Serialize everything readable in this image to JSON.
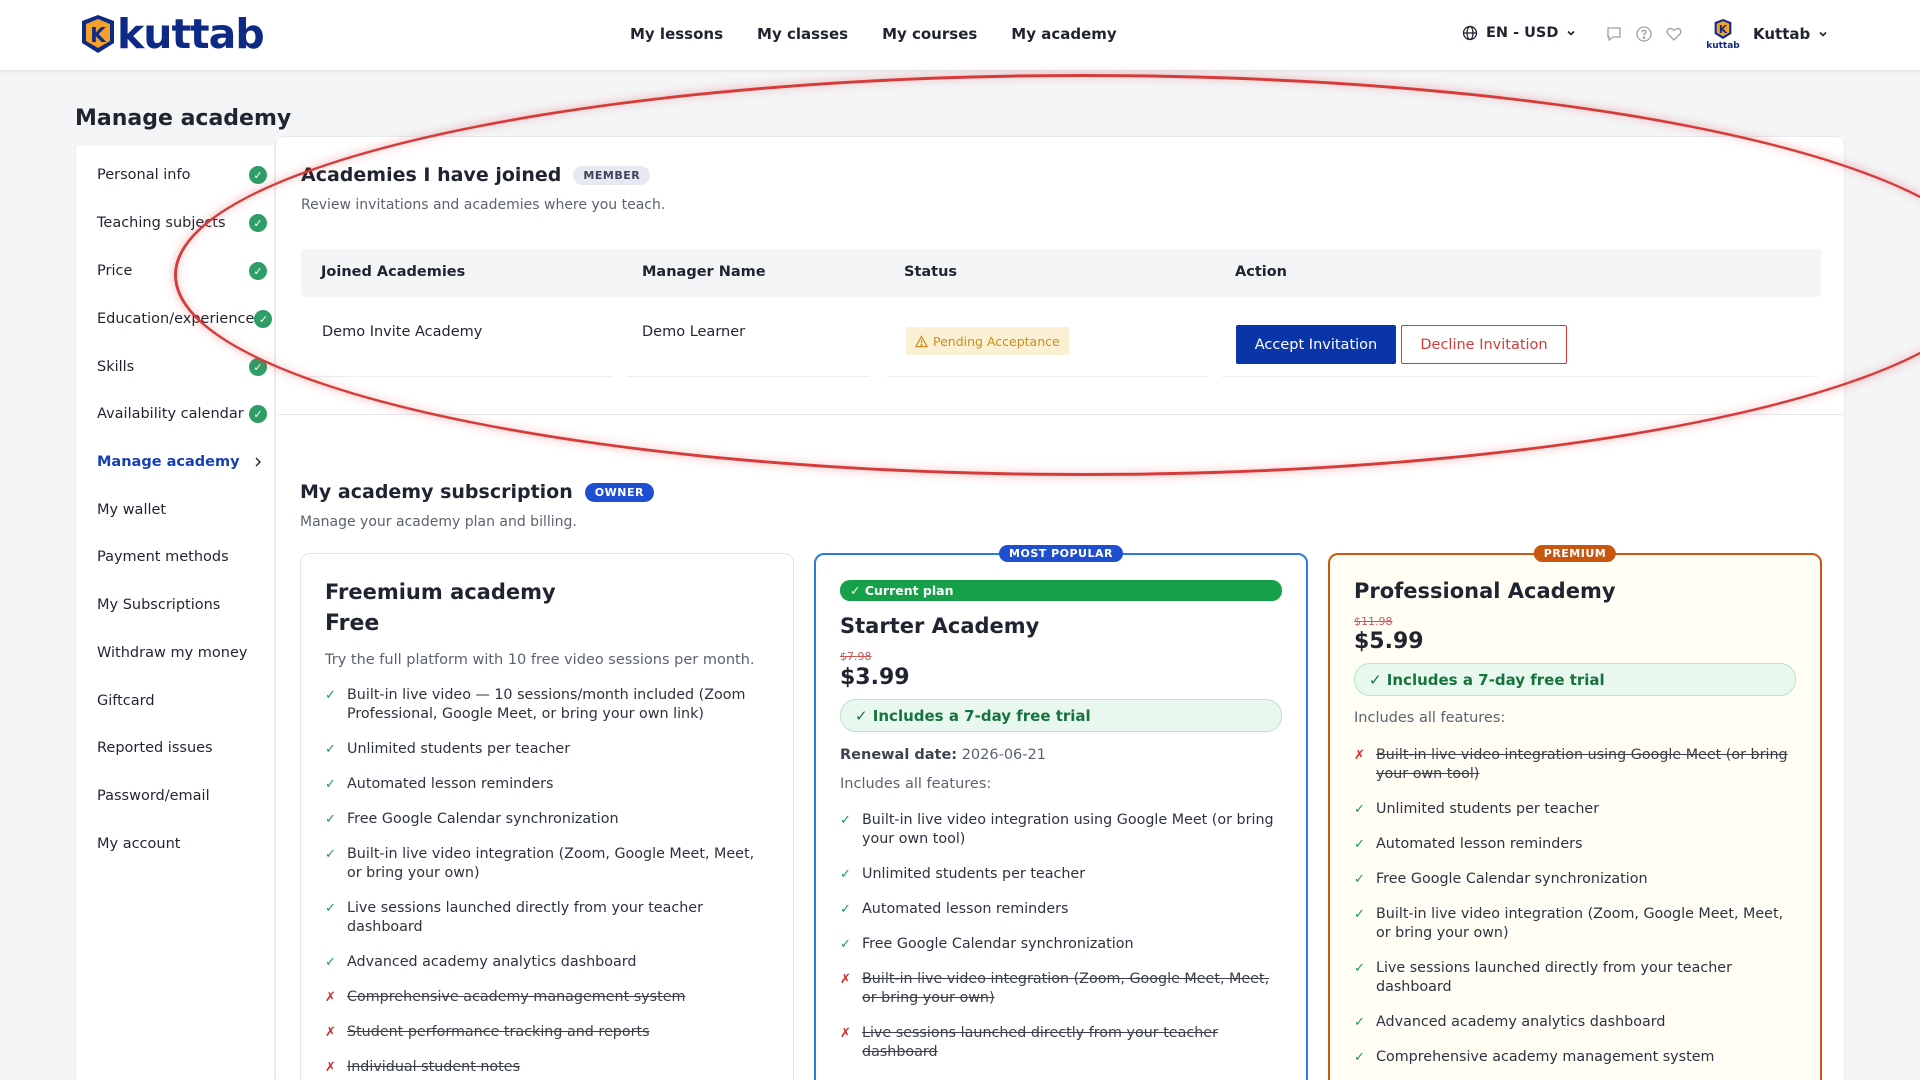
{
  "header": {
    "logo_text": "kuttab",
    "nav": [
      "My lessons",
      "My classes",
      "My courses",
      "My academy"
    ],
    "language": "EN - USD",
    "avatar_caption": "kuttab",
    "user_name": "Kuttab"
  },
  "page_title": "Manage academy",
  "sidebar": {
    "items": [
      {
        "label": "Personal info",
        "completed": true
      },
      {
        "label": "Teaching subjects",
        "completed": true
      },
      {
        "label": "Price",
        "completed": true
      },
      {
        "label": "Education/experience",
        "completed": true
      },
      {
        "label": "Skills",
        "completed": true
      },
      {
        "label": "Availability calendar",
        "completed": true
      },
      {
        "label": "Manage academy",
        "active": true
      },
      {
        "label": "My wallet"
      },
      {
        "label": "Payment methods"
      },
      {
        "label": "My Subscriptions"
      },
      {
        "label": "Withdraw my money"
      },
      {
        "label": "Giftcard"
      },
      {
        "label": "Reported issues"
      },
      {
        "label": "Password/email"
      },
      {
        "label": "My account"
      }
    ]
  },
  "joined": {
    "title": "Academies I have joined",
    "badge": "MEMBER",
    "subtitle": "Review invitations and academies where you teach.",
    "columns": [
      "Joined Academies",
      "Manager Name",
      "Status",
      "Action"
    ],
    "rows": [
      {
        "academy": "Demo Invite Academy",
        "manager": "Demo Learner",
        "status": "Pending Acceptance",
        "accept_label": "Accept Invitation",
        "decline_label": "Decline Invitation"
      }
    ]
  },
  "subscription": {
    "title": "My academy subscription",
    "badge": "OWNER",
    "subtitle": "Manage your academy plan and billing.",
    "plans": [
      {
        "name": "Freemium academy",
        "price": "Free",
        "description": "Try the full platform with 10 free video sessions per month.",
        "features": [
          {
            "text": "Built-in live video — 10 sessions/month included (Zoom Professional, Google Meet, or bring your own link)",
            "included": true
          },
          {
            "text": "Unlimited students per teacher",
            "included": true
          },
          {
            "text": "Automated lesson reminders",
            "included": true
          },
          {
            "text": "Free Google Calendar synchronization",
            "included": true
          },
          {
            "text": "Built-in live video integration (Zoom, Google Meet, Meet, or bring your own)",
            "included": true
          },
          {
            "text": "Live sessions launched directly from your teacher dashboard",
            "included": true
          },
          {
            "text": "Advanced academy analytics dashboard",
            "included": true
          },
          {
            "text": "Comprehensive academy management system",
            "included": false
          },
          {
            "text": "Student performance tracking and reports",
            "included": false
          },
          {
            "text": "Individual student notes",
            "included": false
          }
        ]
      },
      {
        "top_badge": "MOST POPULAR",
        "current_label": "✓ Current plan",
        "name": "Starter Academy",
        "old_price": "$7.98",
        "price": "$3.99",
        "trial": "✓ Includes a 7-day free trial",
        "renewal_label": "Renewal date:",
        "renewal_date": "2026-06-21",
        "includes_label": "Includes all features:",
        "features": [
          {
            "text": "Built-in live video integration using Google Meet (or bring your own tool)",
            "included": true
          },
          {
            "text": "Unlimited students per teacher",
            "included": true
          },
          {
            "text": "Automated lesson reminders",
            "included": true
          },
          {
            "text": "Free Google Calendar synchronization",
            "included": true
          },
          {
            "text": "Built-in live video integration (Zoom, Google Meet, Meet, or bring your own)",
            "included": false
          },
          {
            "text": "Live sessions launched directly from your teacher dashboard",
            "included": false
          }
        ]
      },
      {
        "top_badge": "PREMIUM",
        "name": "Professional Academy",
        "old_price": "$11.98",
        "price": "$5.99",
        "trial": "✓ Includes a 7-day free trial",
        "includes_label": "Includes all features:",
        "features": [
          {
            "text": "Built-in live video integration using Google Meet (or bring your own tool)",
            "included": false
          },
          {
            "text": "Unlimited students per teacher",
            "included": true
          },
          {
            "text": "Automated lesson reminders",
            "included": true
          },
          {
            "text": "Free Google Calendar synchronization",
            "included": true
          },
          {
            "text": "Built-in live video integration (Zoom, Google Meet, Meet, or bring your own)",
            "included": true
          },
          {
            "text": "Live sessions launched directly from your teacher dashboard",
            "included": true
          },
          {
            "text": "Advanced academy analytics dashboard",
            "included": true
          },
          {
            "text": "Comprehensive academy management system",
            "included": true
          }
        ]
      }
    ]
  },
  "colors": {
    "brand": "#0f2a86",
    "accent": "#0a35a8",
    "success": "#2f9e65",
    "danger": "#d33a3a",
    "warning": "#c8901a",
    "annotation": "#d63b3b"
  }
}
